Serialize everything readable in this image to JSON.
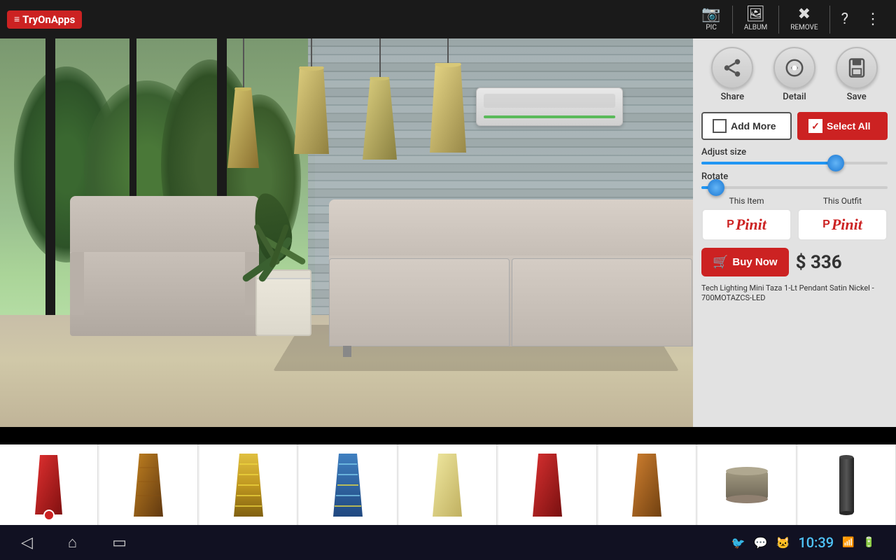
{
  "app": {
    "logo": "TryOnApps",
    "logo_menu": "≡"
  },
  "topbar": {
    "pic_label": "PIC",
    "album_label": "ALBUM",
    "remove_label": "REMOVE",
    "help_icon": "?",
    "more_icon": "⋮"
  },
  "actions": {
    "share_label": "Share",
    "detail_label": "Detail",
    "save_label": "Save"
  },
  "buttons": {
    "add_more": "Add More",
    "select_all": "Select All",
    "buy_now": "Buy Now",
    "this_item": "This Item",
    "this_outfit": "This Outfit"
  },
  "sliders": {
    "adjust_size_label": "Adjust size",
    "adjust_size_pct": 72,
    "rotate_label": "Rotate",
    "rotate_pct": 8
  },
  "product": {
    "price": "$ 336",
    "name": "Tech Lighting Mini Taza 1-Lt Pendant Satin Nickel - 700MOTAZCS-LED"
  },
  "pinit": {
    "text": "Pinit"
  },
  "navbar": {
    "clock": "10:39"
  },
  "thumbnails": [
    {
      "id": 0,
      "color": "#cc2222",
      "shape": "cone",
      "active": false
    },
    {
      "id": 1,
      "color": "#8b4010",
      "shape": "cone",
      "active": false
    },
    {
      "id": 2,
      "color": "#c8a020",
      "shape": "cone-striped",
      "active": false
    },
    {
      "id": 3,
      "color": "#2060a0",
      "shape": "cone-striped",
      "active": false
    },
    {
      "id": 4,
      "color": "#e0d080",
      "shape": "cone",
      "active": false
    },
    {
      "id": 5,
      "color": "#cc1010",
      "shape": "cone",
      "active": false
    },
    {
      "id": 6,
      "color": "#c07020",
      "shape": "cone",
      "active": false
    },
    {
      "id": 7,
      "color": "#888070",
      "shape": "drum",
      "active": false
    },
    {
      "id": 8,
      "color": "#1a1a1a",
      "shape": "cylinder",
      "active": false
    }
  ]
}
